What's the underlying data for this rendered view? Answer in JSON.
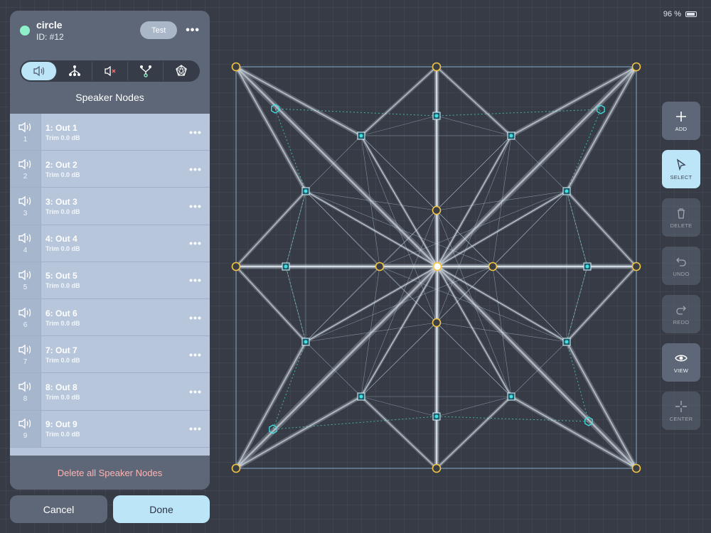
{
  "status_bar": {
    "battery": "96 %"
  },
  "panel": {
    "name": "circle",
    "id": "ID: #12",
    "test_label": "Test",
    "more": "•••",
    "section_title": "Speaker Nodes",
    "tabs": [
      {
        "icon": "speaker-icon",
        "active": true
      },
      {
        "icon": "hierarchy-icon",
        "active": false
      },
      {
        "icon": "speaker-muted-icon",
        "active": false
      },
      {
        "icon": "tree-node-icon",
        "active": false
      },
      {
        "icon": "network-star-icon",
        "active": false
      }
    ],
    "nodes": [
      {
        "num": "1",
        "name": "1: Out 1",
        "trim": "Trim 0.0 dB"
      },
      {
        "num": "2",
        "name": "2: Out 2",
        "trim": "Trim 0.0 dB"
      },
      {
        "num": "3",
        "name": "3: Out 3",
        "trim": "Trim 0.0 dB"
      },
      {
        "num": "4",
        "name": "4: Out 4",
        "trim": "Trim 0.0 dB"
      },
      {
        "num": "5",
        "name": "5: Out 5",
        "trim": "Trim 0.0 dB"
      },
      {
        "num": "6",
        "name": "6: Out 6",
        "trim": "Trim 0.0 dB"
      },
      {
        "num": "7",
        "name": "7: Out 7",
        "trim": "Trim 0.0 dB"
      },
      {
        "num": "8",
        "name": "8: Out 8",
        "trim": "Trim 0.0 dB"
      },
      {
        "num": "9",
        "name": "9: Out 9",
        "trim": "Trim 0.0 dB"
      }
    ],
    "delete_all": "Delete all Speaker Nodes"
  },
  "footer": {
    "cancel": "Cancel",
    "done": "Done"
  },
  "tools": [
    {
      "label": "ADD",
      "icon": "plus-icon",
      "state": "normal"
    },
    {
      "label": "SELECT",
      "icon": "cursor-icon",
      "state": "active"
    },
    {
      "label": "DELETE",
      "icon": "trash-icon",
      "state": "disabled"
    },
    {
      "label": "UNDO",
      "icon": "undo-icon",
      "state": "disabled"
    },
    {
      "label": "REDO",
      "icon": "redo-icon",
      "state": "disabled"
    },
    {
      "label": "VIEW",
      "icon": "eye-icon",
      "state": "normal"
    },
    {
      "label": "CENTER",
      "icon": "center-icon",
      "state": "disabled"
    }
  ],
  "colors": {
    "background": "#363b46",
    "panel": "#5d6777",
    "accent": "#bde5f8",
    "status_dot": "#8ef0c9",
    "node_yellow": "#f4c542",
    "node_cyan": "#3fe0e0",
    "delete_text": "#ffb3b3"
  }
}
